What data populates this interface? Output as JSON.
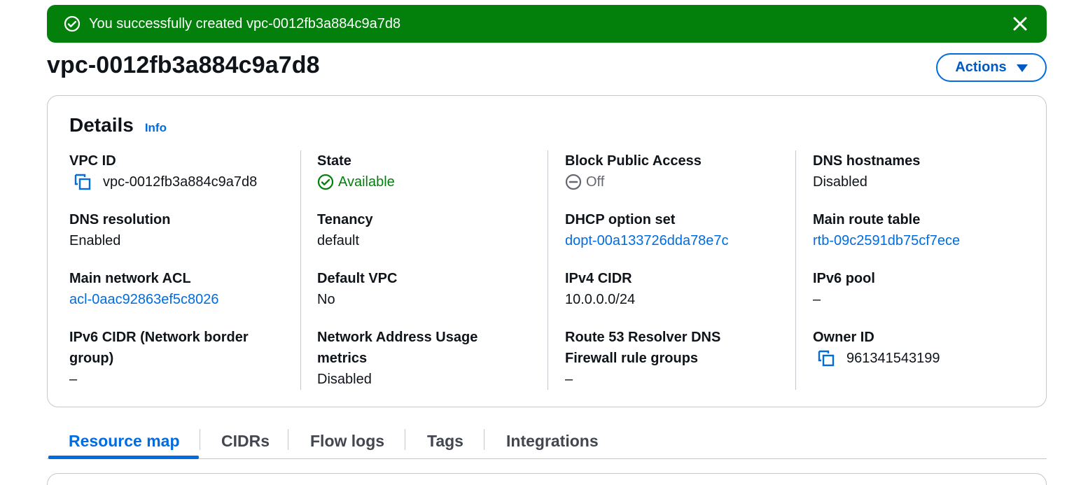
{
  "flash": {
    "message": "You successfully created vpc-0012fb3a884c9a7d8",
    "color": "#037f0c"
  },
  "page": {
    "title": "vpc-0012fb3a884c9a7d8",
    "actions_label": "Actions"
  },
  "details": {
    "title": "Details",
    "info_label": "Info",
    "columns": [
      [
        {
          "label": "VPC ID",
          "value": "vpc-0012fb3a884c9a7d8"
        },
        {
          "label": "DNS resolution",
          "value": "Enabled"
        },
        {
          "label": "Main network ACL",
          "value": "acl-0aac92863ef5c8026"
        },
        {
          "label": "IPv6 CIDR (Network border group)",
          "value": "–"
        }
      ],
      [
        {
          "label": "State",
          "value": "Available"
        },
        {
          "label": "Tenancy",
          "value": "default"
        },
        {
          "label": "Default VPC",
          "value": "No"
        },
        {
          "label": "Network Address Usage metrics",
          "value": "Disabled"
        }
      ],
      [
        {
          "label": "Block Public Access",
          "value": "Off"
        },
        {
          "label": "DHCP option set",
          "value": "dopt-00a133726dda78e7c"
        },
        {
          "label": "IPv4 CIDR",
          "value": "10.0.0.0/24"
        },
        {
          "label": "Route 53 Resolver DNS Firewall rule groups",
          "value": "–"
        }
      ],
      [
        {
          "label": "DNS hostnames",
          "value": "Disabled"
        },
        {
          "label": "Main route table",
          "value": "rtb-09c2591db75cf7ece"
        },
        {
          "label": "IPv6 pool",
          "value": "–"
        },
        {
          "label": "Owner ID",
          "value": "961341543199"
        }
      ]
    ]
  },
  "tabs": [
    {
      "label": "Resource map",
      "active": true
    },
    {
      "label": "CIDRs"
    },
    {
      "label": "Flow logs"
    },
    {
      "label": "Tags"
    },
    {
      "label": "Integrations"
    }
  ],
  "colors": {
    "link": "#006ce0",
    "success": "#037f0c",
    "border": "#c6c6cd"
  }
}
